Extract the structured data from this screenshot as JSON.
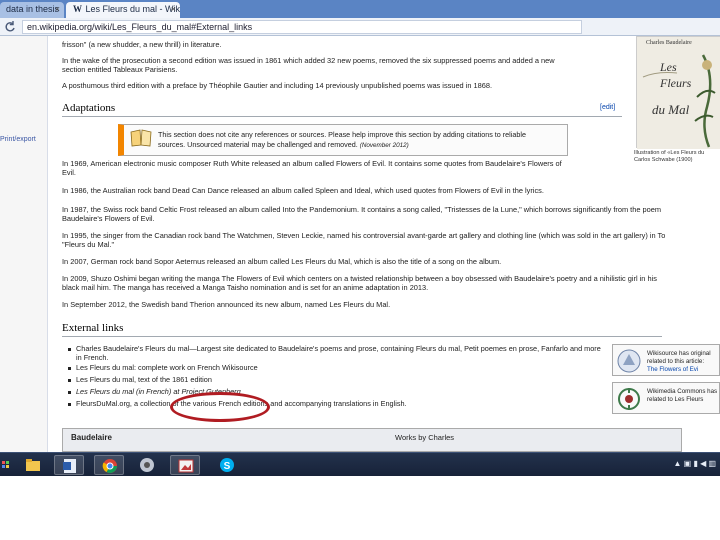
{
  "browser": {
    "tabs": [
      {
        "label": "data in thesis",
        "close": "×"
      },
      {
        "label": "Les Fleurs du mal - Wikip",
        "close": "×",
        "favicon": "W"
      }
    ],
    "address": "en.wikipedia.org/wiki/Les_Fleurs_du_mal#External_links"
  },
  "sidebar": {
    "link": "Print/export"
  },
  "article": {
    "p_top": [
      "frisson\" (a new shudder, a new thrill) in literature.",
      "In the wake of the prosecution a second edition was issued in 1861 which added 32 new poems, removed the six suppressed poems and added a new",
      "section entitled Tableaux Parisiens.",
      "A posthumous third edition with a preface by Théophile Gautier and including 14 previously unpublished poems was issued in 1868."
    ],
    "adaptations_heading": "Adaptations",
    "edit_label": "[edit]",
    "ambox": {
      "line1": "This section does not cite any references or sources. Please help improve this section by adding citations to reliable",
      "line2": "sources. Unsourced material may be challenged and removed.",
      "date": "(November 2012)"
    },
    "infobox": {
      "image_header": "Charles Baudelaire",
      "image_title_1": "Les",
      "image_title_2": "Fleurs",
      "image_title_3": "du Mal",
      "caption_1": "Illustration of «Les Fleurs du",
      "caption_2": "Carlos Schwabe (1900)"
    },
    "adaptations": [
      "In 1969, American electronic music composer Ruth White released an album called Flowers of Evil. It contains some quotes from Baudelaire's Flowers of",
      "Evil.",
      "In 1986, the Australian rock band Dead Can Dance released an album called Spleen and Ideal, which used quotes from Flowers of Evil in the lyrics.",
      "In 1987, the Swiss rock band Celtic Frost released an album called Into the Pandemonium. It contains a song called, \"Tristesses de la Lune,\" which borrows significantly from the poem",
      "Baudelaire's Flowers of Evil.",
      "In 1995, the singer from the Canadian rock band The Watchmen, Steven Leckie, named his controversial avant-garde art gallery and clothing line (which was sold in the art gallery) in To",
      "\"Fleurs du Mal.\"",
      "In 2007, German rock band Sopor Aeternus released an album called Les Fleurs du Mal, which is also the title of a song on the album.",
      "In 2009, Shuzo Oshimi began writing the manga The Flowers of Evil which centers on a twisted relationship between a boy obsessed with Baudelaire's poetry and a nihilistic girl in his",
      "black mail him. The manga has received a Manga Taisho nomination and is set for an anime adaptation in 2013.",
      "In September 2012, the Swedish band Therion announced its new album, named Les Fleurs du Mal."
    ],
    "external_heading": "External links",
    "external_links": [
      "Charles Baudelaire's Fleurs du mal—Largest site dedicated to Baudelaire's poems and prose, containing Fleurs du mal, Petit poemes en prose, Fanfarlo and more",
      "in French.",
      "Les Fleurs du mal: complete work on French Wikisource",
      "Les Fleurs du mal, text of the 1861 edition",
      "Les Fleurs du mal (in French) at Project Gutenberg",
      "FleursDuMal.org, a collection of the various French editions and accompanying translations in English."
    ],
    "sister": [
      {
        "t1": "Wikisource has original",
        "t2": "related to this article:",
        "t3": "The Flowers of Evi"
      },
      {
        "t1": "Wikimedia Commons has",
        "t2": "related to Les Fleurs",
        "t3": ""
      }
    ],
    "navbox": {
      "title": "Baudelaire",
      "right": "Works by Charles"
    }
  },
  "taskbar": {
    "tray_text": "▲ ▣ ▮ ◀ ▥"
  }
}
